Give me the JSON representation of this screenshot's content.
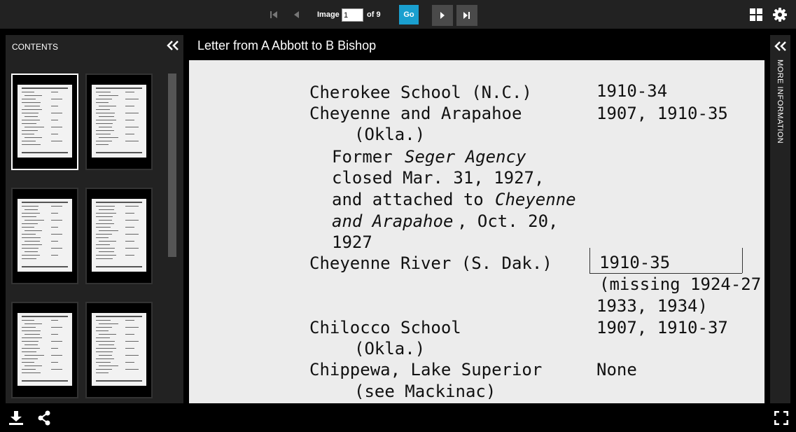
{
  "toolbar": {
    "image_label": "Image",
    "current_image": "1",
    "of_label": "of 9",
    "go_label": "Go",
    "icons": [
      "first-page-icon",
      "prev-page-icon",
      "next-page-icon",
      "last-page-icon",
      "grid-view-icon",
      "gear-icon"
    ]
  },
  "sidebar": {
    "title": "CONTENTS",
    "thumbnail_count": 6,
    "active_thumbnail": 1
  },
  "document": {
    "title": "Letter from A Abbott to B Bishop",
    "lines": [
      {
        "text": "Cherokee School (N.C.)",
        "style": "normal"
      },
      {
        "text": "1910-34",
        "style": "normal"
      },
      {
        "text": "Cheyenne and Arapahoe",
        "style": "normal"
      },
      {
        "text": "1907, 1910-35",
        "style": "normal"
      },
      {
        "text": "(Okla.)",
        "style": "normal"
      },
      {
        "text": "Former ",
        "style": "normal"
      },
      {
        "text": "Seger Agency",
        "style": "italic"
      },
      {
        "text": "closed Mar. 31, 1927,",
        "style": "normal"
      },
      {
        "text": "and attached to ",
        "style": "normal"
      },
      {
        "text": "Cheyenne",
        "style": "italic"
      },
      {
        "text": "and Arapahoe",
        "style": "italic"
      },
      {
        "text": ", Oct. 20,",
        "style": "normal"
      },
      {
        "text": "1927",
        "style": "normal"
      },
      {
        "text": "Cheyenne River (S. Dak.)",
        "style": "normal"
      },
      {
        "text": "1910-35",
        "style": "normal"
      },
      {
        "text": "(missing 1924-27",
        "style": "normal"
      },
      {
        "text": "1933, 1934)",
        "style": "normal"
      },
      {
        "text": "Chilocco School",
        "style": "normal"
      },
      {
        "text": "1907, 1910-37",
        "style": "normal"
      },
      {
        "text": "(Okla.)",
        "style": "normal"
      },
      {
        "text": "Chippewa, Lake Superior",
        "style": "normal"
      },
      {
        "text": "None",
        "style": "normal"
      },
      {
        "text": "(see Mackinac)",
        "style": "normal"
      }
    ]
  },
  "right_panel": {
    "label": "MORE INFORMATION"
  },
  "bottombar": {
    "icons": [
      "download-icon",
      "share-icon",
      "fullscreen-icon"
    ]
  }
}
